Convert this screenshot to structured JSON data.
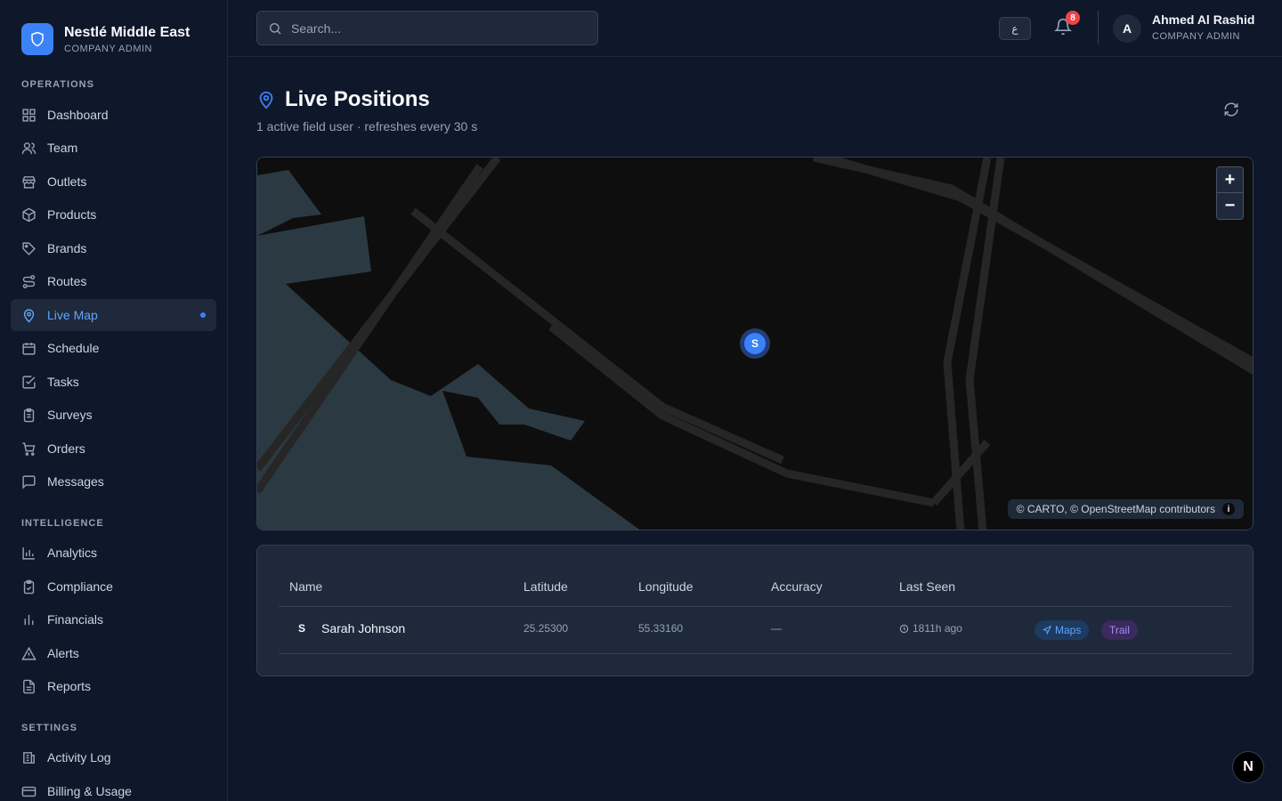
{
  "brand": {
    "name": "Nestlé Middle East",
    "role": "COMPANY ADMIN"
  },
  "sidebar": {
    "sections": [
      {
        "label": "OPERATIONS"
      },
      {
        "label": "INTELLIGENCE"
      },
      {
        "label": "SETTINGS"
      }
    ],
    "items": [
      {
        "label": "Dashboard",
        "icon": "dashboard-icon"
      },
      {
        "label": "Team",
        "icon": "users-icon"
      },
      {
        "label": "Outlets",
        "icon": "store-icon"
      },
      {
        "label": "Products",
        "icon": "package-icon"
      },
      {
        "label": "Brands",
        "icon": "tag-icon"
      },
      {
        "label": "Routes",
        "icon": "route-icon"
      },
      {
        "label": "Live Map",
        "icon": "map-pin-icon",
        "active": true
      },
      {
        "label": "Schedule",
        "icon": "calendar-icon"
      },
      {
        "label": "Tasks",
        "icon": "check-square-icon"
      },
      {
        "label": "Surveys",
        "icon": "clipboard-icon"
      },
      {
        "label": "Orders",
        "icon": "cart-icon"
      },
      {
        "label": "Messages",
        "icon": "message-icon"
      },
      {
        "label": "Analytics",
        "icon": "bar-chart-icon"
      },
      {
        "label": "Compliance",
        "icon": "clipboard-check-icon"
      },
      {
        "label": "Financials",
        "icon": "chart-icon"
      },
      {
        "label": "Alerts",
        "icon": "alert-icon"
      },
      {
        "label": "Reports",
        "icon": "file-icon"
      },
      {
        "label": "Activity Log",
        "icon": "log-icon"
      },
      {
        "label": "Billing & Usage",
        "icon": "credit-card-icon"
      }
    ]
  },
  "header": {
    "search_placeholder": "Search...",
    "language_label": "ع",
    "notification_count": "8",
    "user": {
      "initial": "A",
      "name": "Ahmed Al Rashid",
      "role": "COMPANY ADMIN"
    }
  },
  "page": {
    "title": "Live Positions",
    "subtitle": "1 active field user · refreshes every 30 s"
  },
  "map": {
    "zoom_in": "+",
    "zoom_out": "−",
    "attribution": "© CARTO, © OpenStreetMap contributors",
    "info": "i",
    "markers": [
      {
        "initial": "S"
      }
    ]
  },
  "table": {
    "columns": [
      "Name",
      "Latitude",
      "Longitude",
      "Accuracy",
      "Last Seen"
    ],
    "rows": [
      {
        "initial": "S",
        "name": "Sarah Johnson",
        "latitude": "25.25300",
        "longitude": "55.33160",
        "accuracy": "—",
        "last_seen": "1811h ago",
        "actions": [
          "Maps",
          "Trail"
        ]
      }
    ]
  },
  "footer_badge": "N",
  "colors": {
    "accent": "#3b82f6",
    "background": "#0f172a",
    "panel": "#1e293b",
    "badge": "#ef4444"
  }
}
